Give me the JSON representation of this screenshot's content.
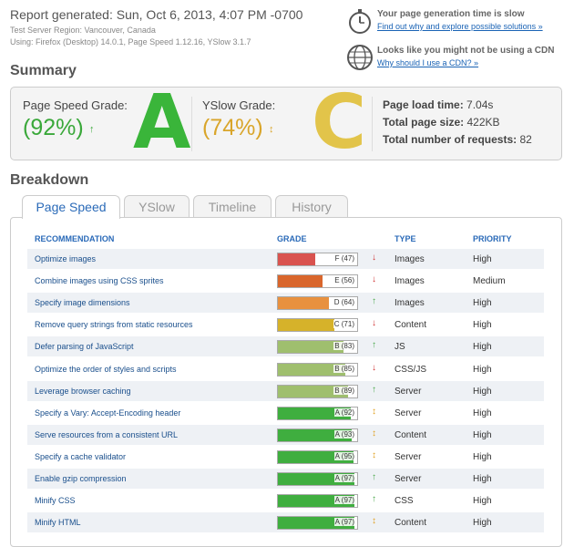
{
  "header": {
    "report_line": "Report generated: Sun, Oct 6, 2013, 4:07 PM -0700",
    "server_region": "Test Server Region: Vancouver, Canada",
    "using": "Using: Firefox (Desktop) 14.0.1, Page Speed 1.12.16, YSlow 3.1.7"
  },
  "notices": {
    "time": {
      "title": "Your page generation time is slow",
      "link": "Find out why and explore possible solutions »"
    },
    "cdn": {
      "title": "Looks like you might not be using a CDN",
      "link": "Why should I use a CDN? »"
    }
  },
  "summary": {
    "title": "Summary",
    "pagespeed": {
      "label": "Page Speed Grade:",
      "pct": "(92%)",
      "arrow": "↑",
      "letter": "A"
    },
    "yslow": {
      "label": "YSlow Grade:",
      "pct": "(74%)",
      "arrow": "↕",
      "letter": "C"
    },
    "load_time_label": "Page load time:",
    "load_time": "7.04s",
    "size_label": "Total page size:",
    "size": "422KB",
    "requests_label": "Total number of requests:",
    "requests": "82"
  },
  "breakdown": {
    "title": "Breakdown",
    "tabs": [
      "Page Speed",
      "YSlow",
      "Timeline",
      "History"
    ],
    "headers": {
      "recommendation": "RECOMMENDATION",
      "grade": "GRADE",
      "type": "TYPE",
      "priority": "PRIORITY"
    },
    "rows": [
      {
        "name": "Optimize images",
        "grade": "F (47)",
        "score": 47,
        "color": "#d9534f",
        "arrow": "↓",
        "arrow_color": "#d03030",
        "type": "Images",
        "priority": "High"
      },
      {
        "name": "Combine images using CSS sprites",
        "grade": "E (56)",
        "score": 56,
        "color": "#d9662c",
        "arrow": "↓",
        "arrow_color": "#d03030",
        "type": "Images",
        "priority": "Medium"
      },
      {
        "name": "Specify image dimensions",
        "grade": "D (64)",
        "score": 64,
        "color": "#e8913f",
        "arrow": "↑",
        "arrow_color": "#4aa84a",
        "type": "Images",
        "priority": "High"
      },
      {
        "name": "Remove query strings from static resources",
        "grade": "C (71)",
        "score": 71,
        "color": "#d6b22a",
        "arrow": "↓",
        "arrow_color": "#d03030",
        "type": "Content",
        "priority": "High"
      },
      {
        "name": "Defer parsing of JavaScript",
        "grade": "B (83)",
        "score": 83,
        "color": "#9fbf6e",
        "arrow": "↑",
        "arrow_color": "#4aa84a",
        "type": "JS",
        "priority": "High"
      },
      {
        "name": "Optimize the order of styles and scripts",
        "grade": "B (85)",
        "score": 85,
        "color": "#9fbf6e",
        "arrow": "↓",
        "arrow_color": "#d03030",
        "type": "CSS/JS",
        "priority": "High"
      },
      {
        "name": "Leverage browser caching",
        "grade": "B (89)",
        "score": 89,
        "color": "#9fbf6e",
        "arrow": "↑",
        "arrow_color": "#4aa84a",
        "type": "Server",
        "priority": "High"
      },
      {
        "name": "Specify a Vary: Accept-Encoding header",
        "grade": "A (92)",
        "score": 92,
        "color": "#3fae3f",
        "arrow": "↕",
        "arrow_color": "#e0a020",
        "type": "Server",
        "priority": "High"
      },
      {
        "name": "Serve resources from a consistent URL",
        "grade": "A (93)",
        "score": 93,
        "color": "#3fae3f",
        "arrow": "↕",
        "arrow_color": "#e0a020",
        "type": "Content",
        "priority": "High"
      },
      {
        "name": "Specify a cache validator",
        "grade": "A (95)",
        "score": 95,
        "color": "#3fae3f",
        "arrow": "↕",
        "arrow_color": "#e0a020",
        "type": "Server",
        "priority": "High"
      },
      {
        "name": "Enable gzip compression",
        "grade": "A (97)",
        "score": 97,
        "color": "#3fae3f",
        "arrow": "↑",
        "arrow_color": "#4aa84a",
        "type": "Server",
        "priority": "High"
      },
      {
        "name": "Minify CSS",
        "grade": "A (97)",
        "score": 97,
        "color": "#3fae3f",
        "arrow": "↑",
        "arrow_color": "#4aa84a",
        "type": "CSS",
        "priority": "High"
      },
      {
        "name": "Minify HTML",
        "grade": "A (97)",
        "score": 97,
        "color": "#3fae3f",
        "arrow": "↕",
        "arrow_color": "#e0a020",
        "type": "Content",
        "priority": "High"
      }
    ]
  }
}
